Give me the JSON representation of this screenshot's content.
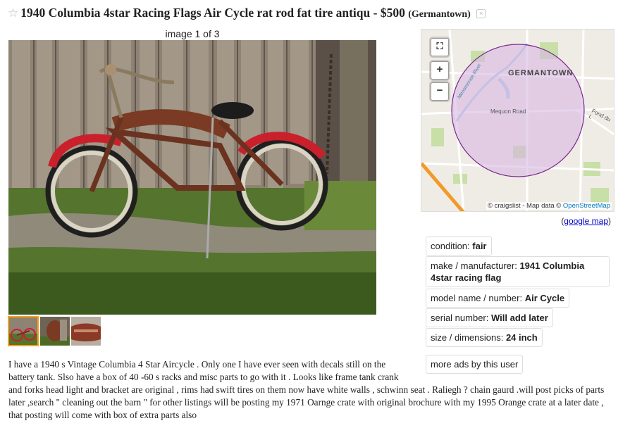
{
  "posting": {
    "title": "1940 Columbia 4star Racing Flags Air Cycle rat rod fat tire antiqu",
    "separator": " - ",
    "price": "$500",
    "location": "(Germantown)"
  },
  "gallery": {
    "counter": "image 1 of 3",
    "selected_index": 1,
    "thumb_count": 3
  },
  "map": {
    "zoom_in": "+",
    "zoom_out": "−",
    "place_label": "GERMANTOWN",
    "road_labels": [
      "Mequon Road",
      "Fond du L",
      "Menomonee River"
    ],
    "attribution_prefix": "© craigslist - Map data © ",
    "attribution_link": "OpenStreetMap",
    "google_map_open": "(",
    "google_map_link": "google map",
    "google_map_close": ")",
    "colors": {
      "radius_fill": "#d7b8e3",
      "radius_stroke": "#7c2a8e",
      "highway": "#f29a26"
    }
  },
  "attributes": [
    {
      "label": "condition: ",
      "value": "fair"
    },
    {
      "label": "make / manufacturer: ",
      "value": "1941 Columbia 4star racing flag"
    },
    {
      "label": "model name / number: ",
      "value": "Air Cycle"
    },
    {
      "label": "serial number: ",
      "value": "Will add later"
    },
    {
      "label": "size / dimensions: ",
      "value": "24 inch"
    }
  ],
  "more_ads_label": "more ads by this user",
  "description": "I have a 1940 s Vintage Columbia 4 Star Aircycle . Only one I have ever seen with decals still on the battery tank. Slso have a box of 40 -60 s racks and misc parts to go with it . Looks like frame tank crank and forks head light and bracket are original , rims had swift tires on them now have white walls , schwinn seat . Raliegh ? chain gaurd .will post picks of parts later ,search \" cleaning out the barn \" for other listings will be posting my 1971 Oarnge crate with original brochure with my 1995 Orange crate at a later date , that posting will come with box of extra parts also"
}
